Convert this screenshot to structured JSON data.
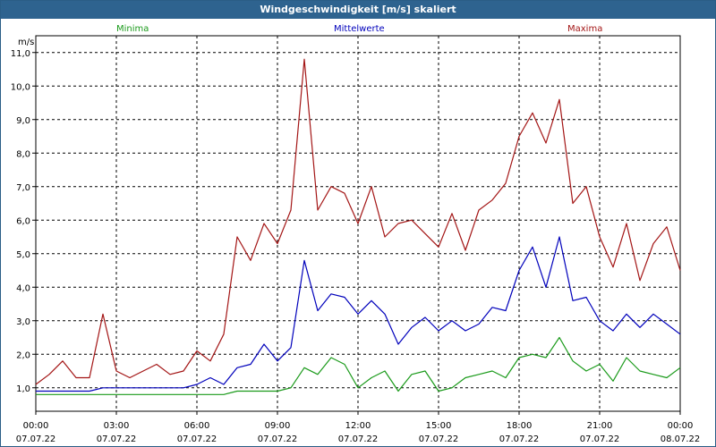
{
  "window": {
    "title": "Windgeschwindigkeit [m/s] skaliert"
  },
  "chart_data": {
    "type": "line",
    "title": "Windgeschwindigkeit [m/s] skaliert",
    "ylabel": "m/s",
    "xlabel": "",
    "ylim": [
      0.3,
      11.5
    ],
    "xlim_hours": [
      0,
      24
    ],
    "grid": true,
    "y_ticks": [
      "1,0",
      "2,0",
      "3,0",
      "4,0",
      "5,0",
      "6,0",
      "7,0",
      "8,0",
      "9,0",
      "10,0",
      "11,0"
    ],
    "x_ticks": [
      {
        "time": "00:00",
        "date": "07.07.22"
      },
      {
        "time": "03:00",
        "date": "07.07.22"
      },
      {
        "time": "06:00",
        "date": "07.07.22"
      },
      {
        "time": "09:00",
        "date": "07.07.22"
      },
      {
        "time": "12:00",
        "date": "07.07.22"
      },
      {
        "time": "15:00",
        "date": "07.07.22"
      },
      {
        "time": "18:00",
        "date": "07.07.22"
      },
      {
        "time": "21:00",
        "date": "07.07.22"
      },
      {
        "time": "00:00",
        "date": "08.07.22"
      }
    ],
    "x_hours": [
      0,
      0.5,
      1,
      1.5,
      2,
      2.5,
      3,
      3.5,
      4,
      4.5,
      5,
      5.5,
      6,
      6.5,
      7,
      7.5,
      8,
      8.5,
      9,
      9.5,
      10,
      10.5,
      11,
      11.5,
      12,
      12.5,
      13,
      13.5,
      14,
      14.5,
      15,
      15.5,
      16,
      16.5,
      17,
      17.5,
      18,
      18.5,
      19,
      19.5,
      20,
      20.5,
      21,
      21.5,
      22,
      22.5,
      23,
      23.5,
      24
    ],
    "series": [
      {
        "name": "Minima",
        "color": "#1a9a1a",
        "values": [
          0.8,
          0.8,
          0.8,
          0.8,
          0.8,
          0.8,
          0.8,
          0.8,
          0.8,
          0.8,
          0.8,
          0.8,
          0.8,
          0.8,
          0.8,
          0.9,
          0.9,
          0.9,
          0.9,
          1.0,
          1.6,
          1.4,
          1.9,
          1.7,
          1.0,
          1.3,
          1.5,
          0.9,
          1.4,
          1.5,
          0.9,
          1.0,
          1.3,
          1.4,
          1.5,
          1.3,
          1.9,
          2.0,
          1.9,
          2.5,
          1.8,
          1.5,
          1.7,
          1.2,
          1.9,
          1.5,
          1.4,
          1.3,
          1.6
        ]
      },
      {
        "name": "Mittelwerte",
        "color": "#0000bb",
        "values": [
          0.9,
          0.9,
          0.9,
          0.9,
          0.9,
          1.0,
          1.0,
          1.0,
          1.0,
          1.0,
          1.0,
          1.0,
          1.1,
          1.3,
          1.1,
          1.6,
          1.7,
          2.3,
          1.8,
          2.2,
          4.8,
          3.3,
          3.8,
          3.7,
          3.2,
          3.6,
          3.2,
          2.3,
          2.8,
          3.1,
          2.7,
          3.0,
          2.7,
          2.9,
          3.4,
          3.3,
          4.5,
          5.2,
          4.0,
          5.5,
          3.6,
          3.7,
          3.0,
          2.7,
          3.2,
          2.8,
          3.2,
          2.9,
          2.6
        ]
      },
      {
        "name": "Maxima",
        "color": "#a31515",
        "values": [
          1.1,
          1.4,
          1.8,
          1.3,
          1.3,
          3.2,
          1.5,
          1.3,
          1.5,
          1.7,
          1.4,
          1.5,
          2.1,
          1.8,
          2.6,
          5.5,
          4.8,
          5.9,
          5.3,
          6.3,
          10.8,
          6.3,
          7.0,
          6.8,
          5.9,
          7.0,
          5.5,
          5.9,
          6.0,
          5.6,
          5.2,
          6.2,
          5.1,
          6.3,
          6.6,
          7.1,
          8.5,
          9.2,
          8.3,
          9.6,
          6.5,
          7.0,
          5.5,
          4.6,
          5.9,
          4.2,
          5.3,
          5.8,
          4.5
        ]
      }
    ],
    "legend_position": "top"
  }
}
